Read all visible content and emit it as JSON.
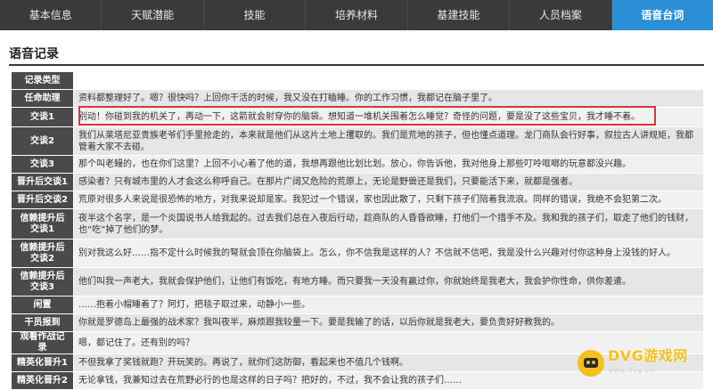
{
  "tabs": [
    {
      "label": "基本信息",
      "active": false
    },
    {
      "label": "天赋潜能",
      "active": false
    },
    {
      "label": "技能",
      "active": false
    },
    {
      "label": "培养材料",
      "active": false
    },
    {
      "label": "基建技能",
      "active": false
    },
    {
      "label": "人员档案",
      "active": false
    },
    {
      "label": "语音台词",
      "active": true
    }
  ],
  "section_title": "语音记录",
  "table": {
    "header": "记录类型",
    "rows": [
      {
        "type": "任命助理",
        "text": "资料都整理好了。嗯？很快吗？上回你干活的时候，我又没在打瞌睡。你的工作习惯，我都记在脑子里了。"
      },
      {
        "type": "交谈1",
        "text": "别动！你碰到我的机关了，再动一下，这箭就会射穿你的脑袋。想知道一堆机关围着怎么睡觉？奇怪的问题，要是没了这些宝贝，我才睡不着。"
      },
      {
        "type": "交谈2",
        "text": "我们从莱塔尼亚贵族老爷们手里抢走的，本来就是他们从这片土地上攫取的。我们是荒地的孩子，但也懂点道理。龙门商队会行好事，叙拉古人讲规矩，我都管着大家不去碰。"
      },
      {
        "type": "交谈3",
        "text": "那个叫老鳗的，也在你们这里？上回不小心着了他的道，我想再跟他比划比划。放心，你告诉他，我对他身上那些叮呤哐啷的玩意都没兴趣。"
      },
      {
        "type": "晋升后交谈1",
        "text": "感染者？只有城市里的人才会这么称呼自己。在那片广阔又危险的荒原上，无论是野兽还是我们，只要能活下来，就都是强者。"
      },
      {
        "type": "晋升后交谈2",
        "text": "荒原对很多人来说是很恐怖的地方，对我来说却是家。我犯过一个错误，家也因此散了，只剩下孩子们陪着我流浪。同样的错误，我绝不会犯第二次。"
      },
      {
        "type": "信赖提升后交谈1",
        "text": "夜半这个名字，是一个炎国说书人给我起的。过去我们总在入夜后行动，趁商队的人昏昏欲睡，打他们一个措手不及。我和我的孩子们，取走了他们的钱财，也“吃”掉了他们的梦。"
      },
      {
        "type": "信赖提升后交谈2",
        "text": "别对我这么好……指不定什么时候我的弩就会顶在你脑袋上。怎么，你不信我是这样的人？不信就不信吧，我是没什么兴趣对付你这种身上没钱的好人。"
      },
      {
        "type": "信赖提升后交谈3",
        "text": "他们叫我一声老大，我就会保护他们，让他们有饭吃，有地方睡。而只要我一天没有赢过你，你就始终是我老大，我会护你性命，供你差遣。"
      },
      {
        "type": "闲置",
        "text": "……抱着小帽睡着了？阿灯，把毯子取过来，动静小一些。"
      },
      {
        "type": "干员报到",
        "text": "你就是罗德岛上最强的战术家？我叫夜半，麻烦跟我较量一下。要是我输了的话，以后你就是我老大，要负责好好教我的。"
      },
      {
        "type": "观看作战记录",
        "text": "嗯，都记住了。还有别的吗？"
      },
      {
        "type": "精英化晋升1",
        "text": "不但我拿了奖钱就跑？开玩笑的。再说了，就你们这防御，看起来也不值几个钱啊。"
      },
      {
        "type": "精英化晋升2",
        "text": "无论拿钱，我兼知过去在荒野必行的也是这样的日子吗？把好的，不过，我不会让我的孩子们……"
      }
    ]
  },
  "watermark": {
    "main": "DVG游戏网",
    "sub": "www.dvg.cn"
  }
}
